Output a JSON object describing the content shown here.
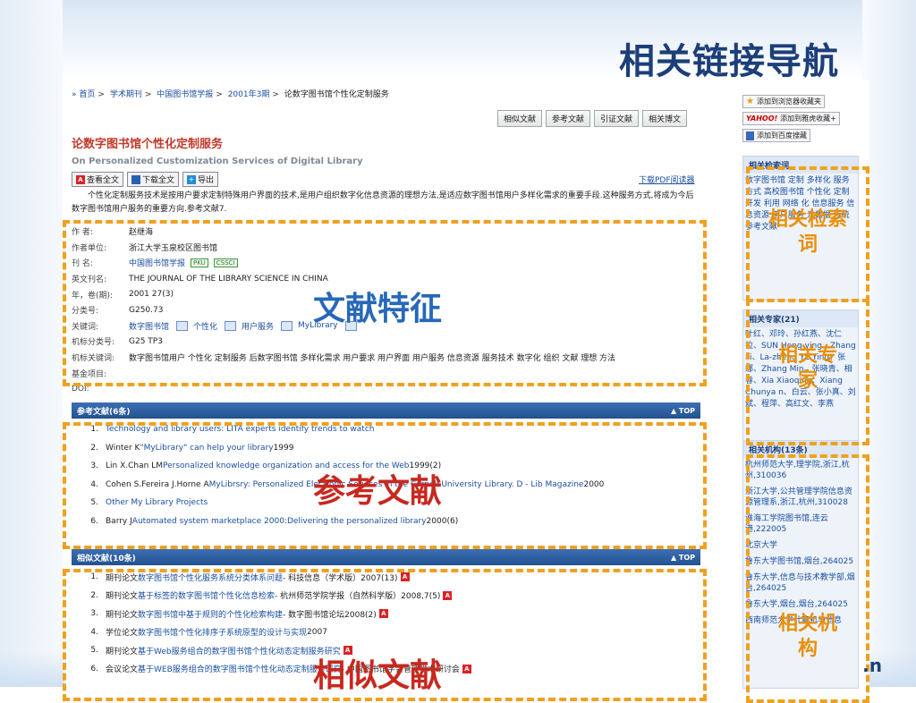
{
  "slide_title": "相关链接导航",
  "breadcrumb": {
    "items": [
      "首页",
      "学术期刊",
      "中国图书馆学报",
      "2001年3期"
    ],
    "current": "论数字图书馆个性化定制服务"
  },
  "tabs": [
    "相似文献",
    "参考文献",
    "引证文献",
    "相关博文"
  ],
  "article": {
    "title_cn": "论数字图书馆个性化定制服务",
    "title_en": "On Personalized Customization Services of Digital Library",
    "actions": [
      "查看全文",
      "下载全文",
      "导出"
    ],
    "reader_link": "下载PDF阅读器",
    "abstract": "个性化定制服务技术是按用户要求定制特殊用户界面的技术,是用户组织数字化信息资源的理想方法,是适应数字图书馆用户多样化需求的重要手段.这种服务方式,将成为今后数字图书馆用户服务的重要方向.参考文献7."
  },
  "info": [
    {
      "label": "作 者:",
      "value": "赵继海",
      "link": true
    },
    {
      "label": "作者单位:",
      "value": "浙江大学玉泉校区图书馆",
      "link": false
    },
    {
      "label": "刊 名:",
      "value": "中国图书馆学报",
      "link": true,
      "badges": [
        "PKU",
        "CSSCI"
      ]
    },
    {
      "label": "英文刊名:",
      "value": "THE JOURNAL OF THE LIBRARY SCIENCE IN CHINA",
      "link": true
    },
    {
      "label": "年，卷(期):",
      "value": "2001 27(3)",
      "link": true
    },
    {
      "label": "分类号:",
      "value": "G250.73",
      "link": false
    },
    {
      "label": "关键词:",
      "value": "",
      "keywords": [
        "数字图书馆",
        "个性化",
        "用户服务",
        "MyLibrary"
      ]
    },
    {
      "label": "机标分类号:",
      "value": "G25 TP3",
      "link": false
    },
    {
      "label": "机标关键词:",
      "value": "数字图书馆用户 个性化 定制服务 后数字图书馆 多样化需求 用户要求 用户界面 用户服务 信息资源 服务技术 数字化 组织 文献 理想 方法",
      "link": true
    },
    {
      "label": "基金项目:",
      "value": "",
      "link": false
    },
    {
      "label": "DOI:",
      "value": "",
      "link": false
    }
  ],
  "refs": {
    "header": "参考文献(6条)",
    "top": "▲ TOP",
    "items": [
      {
        "n": "1.",
        "pre": "",
        "link": "Technology and library users: LITA experts identify trends to watch",
        "post": ""
      },
      {
        "n": "2.",
        "pre": "Winter K ",
        "link": "\"MyLibrary\" can help your library",
        "post": " 1999"
      },
      {
        "n": "3.",
        "pre": "Lin X.Chan LM ",
        "link": "Personalized knowledge organization and access for the Web",
        "post": " 1999(2)"
      },
      {
        "n": "4.",
        "pre": "Cohen S.Fereira J.Horne A ",
        "link": "MyLibrsry: Personalized Electronic Services in the Cornell University Library. D - Lib Magazine",
        "post": " 2000"
      },
      {
        "n": "5.",
        "pre": "",
        "link": "Other My Library Projects",
        "post": ""
      },
      {
        "n": "6.",
        "pre": "Barry J ",
        "link": "Automated system marketplace 2000:Delivering the personalized library",
        "post": " 2000(6)"
      }
    ]
  },
  "similar": {
    "header": "相似文献(10条)",
    "top": "▲ TOP",
    "items": [
      {
        "n": "1.",
        "pre": "期刊论文 ",
        "link": "数字图书馆个性化服务系统分类体系问题",
        "post": " - 科技信息（学术版）2007(13)"
      },
      {
        "n": "2.",
        "pre": "期刊论文 ",
        "link": "基于标签的数字图书馆个性化信息检索",
        "post": " - 杭州师范学院学报（自然科学版）2008,7(5)"
      },
      {
        "n": "3.",
        "pre": "期刊论文 ",
        "link": "数字图书馆中基于规则的个性化检索构建",
        "post": " - 数字图书馆论坛2008(2)"
      },
      {
        "n": "4.",
        "pre": "学位论文 ",
        "link": "数字图书馆个性化排序子系统原型的设计与实现",
        "post": " 2007"
      },
      {
        "n": "5.",
        "pre": "期刊论文 ",
        "link": "基于Web服务组合的数字图书馆个性化动态定制服务研究",
        "post": ""
      },
      {
        "n": "6.",
        "pre": "会议论文 ",
        "link": "基于WEB服务组合的数字图书馆个性化动态定制服务研究",
        "post": " - 中国图书馆学会管理学术研讨会"
      }
    ]
  },
  "sidebar": {
    "buttons": [
      "添加到浏览器收藏夹",
      "添加到雅虎收藏+",
      "添加到百度搜藏"
    ],
    "yahoo": "YAHOO!",
    "terms_head": "相关检索词",
    "terms": "数字图书馆 定制 多样化 服务方式 高校图书馆 个性化 定制 开发 利用 网络 化 信息服务 信息资源 用户服务 元数据 传统 参考文献",
    "experts_head": "相关专家(21)",
    "experts": "叶红、邓玲、孙红燕、沈仁拉、SUN Hong-ying、Zhang Li、La-zhen、YE Ying、张娜、Zhang Min、张晓青、相春、Xia Xiaoqing、Xiang Chunya n、白云、张小真、刘斌、程萍、高红文、李燕",
    "inst_head": "相关机构(13条)",
    "institutions": [
      "杭州师范大学,理学院,浙江,杭州,310036",
      "浙江大学,公共管理学院信息资源管理系,浙江,杭州,310028",
      "淮海工学院图书馆,连云港,222005",
      "北京大学",
      "鲁东大学图书馆,烟台,264025",
      "鲁东大学,信息与技术教学部,烟台,264025",
      "鲁东大学,烟台,烟台,264025",
      "西南师范大学计算机与信息"
    ]
  },
  "overlays": {
    "features": "文献特征",
    "references": "参考文献",
    "similar": "相似文献",
    "terms": "相关检索词",
    "experts": "相关专家",
    "institutions": "相关机构"
  },
  "footer_mark": ".n"
}
